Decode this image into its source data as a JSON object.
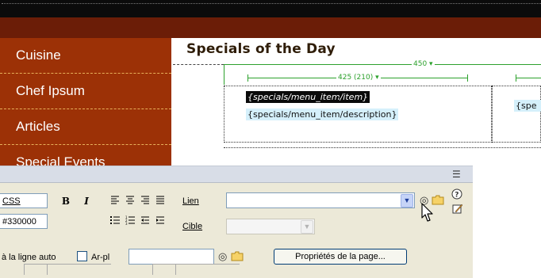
{
  "design_view": {
    "sidebar": {
      "items": [
        {
          "label": "Cuisine"
        },
        {
          "label": "Chef Ipsum"
        },
        {
          "label": "Articles"
        },
        {
          "label": "Special Events"
        }
      ]
    },
    "heading": "Specials of the Day",
    "rulers": {
      "outer_label": "450 ▾",
      "inner_label": "425 (210) ▾"
    },
    "template_fields": {
      "item": "{specials/menu_item/item}",
      "separator": " -",
      "description": "{specials/menu_item/description}",
      "right_partial": "{spe"
    }
  },
  "property_inspector": {
    "style_value": "CSS",
    "bold_label": "B",
    "italic_label": "I",
    "link_label": "Lien",
    "link_value": "",
    "color_value": "#330000",
    "target_label": "Cible",
    "target_value": "",
    "wrap_label": "à la ligne auto",
    "anchor_label": "Ar-pl",
    "anchor_value": "",
    "page_props_button": "Propriétés de la page...",
    "icons": [
      "options-menu-icon",
      "help-icon",
      "quick-tag-editor-icon",
      "point-to-file-icon",
      "browse-folder-icon",
      "align-left-icon",
      "align-center-icon",
      "align-right-icon",
      "justify-icon",
      "unordered-list-icon",
      "ordered-list-icon",
      "outdent-icon",
      "indent-icon",
      "mouse-cursor-icon"
    ]
  },
  "colors": {
    "banner": "#6b1d07",
    "sidebar": "#9c3106",
    "sidebar_divider": "#e7b05a",
    "ruler_green": "#2ca12c",
    "field_highlight": "#d5f0fb",
    "panel_bg": "#ece9d8"
  }
}
